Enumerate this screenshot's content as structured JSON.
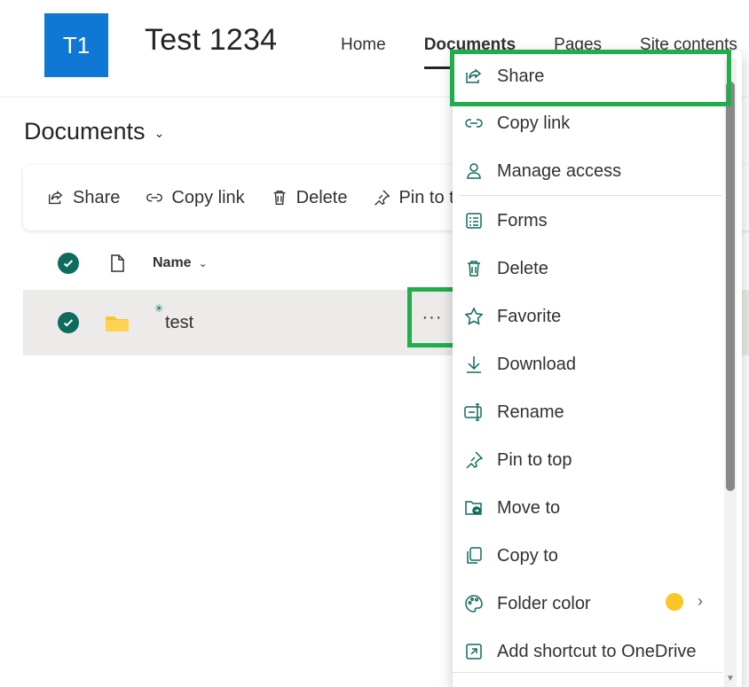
{
  "site": {
    "logo": "T1",
    "title": "Test 1234",
    "nav": [
      {
        "label": "Home"
      },
      {
        "label": "Documents"
      },
      {
        "label": "Pages"
      },
      {
        "label": "Site contents"
      }
    ]
  },
  "library": {
    "title": "Documents",
    "title_chevron": "⌄"
  },
  "commands": [
    {
      "label": "Share",
      "icon": "share-icon"
    },
    {
      "label": "Copy link",
      "icon": "link-icon"
    },
    {
      "label": "Delete",
      "icon": "trash-icon"
    },
    {
      "label": "Pin to top",
      "icon": "pin-icon"
    }
  ],
  "list": {
    "name_header": "Name",
    "name_header_chevron": "⌄",
    "rows": [
      {
        "name": "test",
        "type": "folder"
      }
    ],
    "more_label": "···"
  },
  "menu": {
    "items": [
      {
        "label": "Share",
        "icon": "share-icon"
      },
      {
        "label": "Copy link",
        "icon": "link-icon"
      },
      {
        "label": "Manage access",
        "icon": "person-icon"
      },
      {
        "label": "Forms",
        "icon": "forms-icon"
      },
      {
        "label": "Delete",
        "icon": "trash-icon"
      },
      {
        "label": "Favorite",
        "icon": "star-icon"
      },
      {
        "label": "Download",
        "icon": "download-icon"
      },
      {
        "label": "Rename",
        "icon": "rename-icon"
      },
      {
        "label": "Pin to top",
        "icon": "pin-icon"
      },
      {
        "label": "Move to",
        "icon": "move-icon"
      },
      {
        "label": "Copy to",
        "icon": "copy-icon"
      },
      {
        "label": "Folder color",
        "icon": "palette-icon",
        "color": "#f8c625"
      },
      {
        "label": "Add shortcut to OneDrive",
        "icon": "shortcut-icon"
      }
    ],
    "submenu_chevron": "›"
  },
  "colors": {
    "accent": "#0f6b5e",
    "logo": "#0f78d4",
    "highlight": "#21ad4b"
  }
}
